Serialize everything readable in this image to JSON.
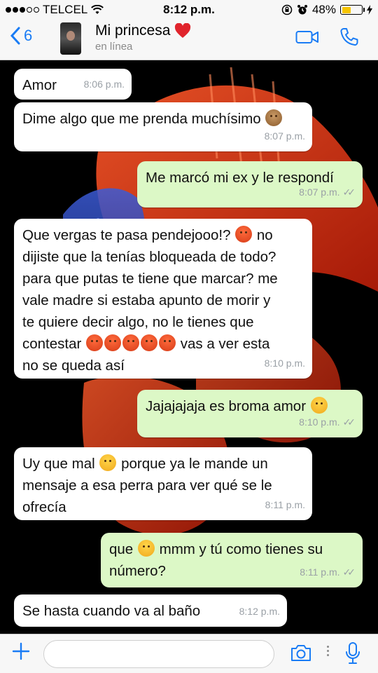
{
  "status_bar": {
    "carrier": "TELCEL",
    "time": "8:12 p.m.",
    "battery": "48%",
    "battery_level": 0.48
  },
  "header": {
    "back_count": "6",
    "contact_name": "Mi princesa",
    "contact_status": "en línea"
  },
  "messages": [
    {
      "direction": "incoming",
      "text": "Amor",
      "time": "8:06 p.m."
    },
    {
      "direction": "incoming",
      "text": "Dime algo que me prenda muchísimo",
      "emoji": "see-no-evil-monkey",
      "time": "8:07 p.m."
    },
    {
      "direction": "outgoing",
      "text": "Me marcó mi ex y le respondí",
      "time": "8:07 p.m."
    },
    {
      "direction": "incoming",
      "lines": [
        "Que vergas te pasa pendejooo!?",
        "no",
        "dijiste que la tenías bloqueada de todo?",
        "para que putas te tiene que marcar? me",
        "vale madre si estaba apunto de morir y",
        "te quiere decir algo, no le tienes que",
        "contestar",
        "vas a ver esta",
        "no se queda así"
      ],
      "time": "8:10 p.m."
    },
    {
      "direction": "outgoing",
      "text": "Jajajajaja es broma amor",
      "emoji": "tears-of-joy",
      "time": "8:10 p.m."
    },
    {
      "direction": "incoming",
      "lines": [
        "Uy que mal",
        "porque ya le mande un",
        "mensaje a esa perra para ver qué se le",
        "ofrecía"
      ],
      "time": "8:11 p.m."
    },
    {
      "direction": "outgoing",
      "lines": [
        "que",
        "mmm y tú como tienes su",
        "número?"
      ],
      "time": "8:11 p.m."
    },
    {
      "direction": "incoming",
      "text": "Se hasta cuando va al baño",
      "time": "8:12 p.m."
    }
  ],
  "colors": {
    "accent": "#1a7cf5",
    "incoming_bubble": "#ffffff",
    "outgoing_bubble": "#dcf8c6",
    "heart": "#e0242c"
  },
  "input": {
    "placeholder": ""
  }
}
